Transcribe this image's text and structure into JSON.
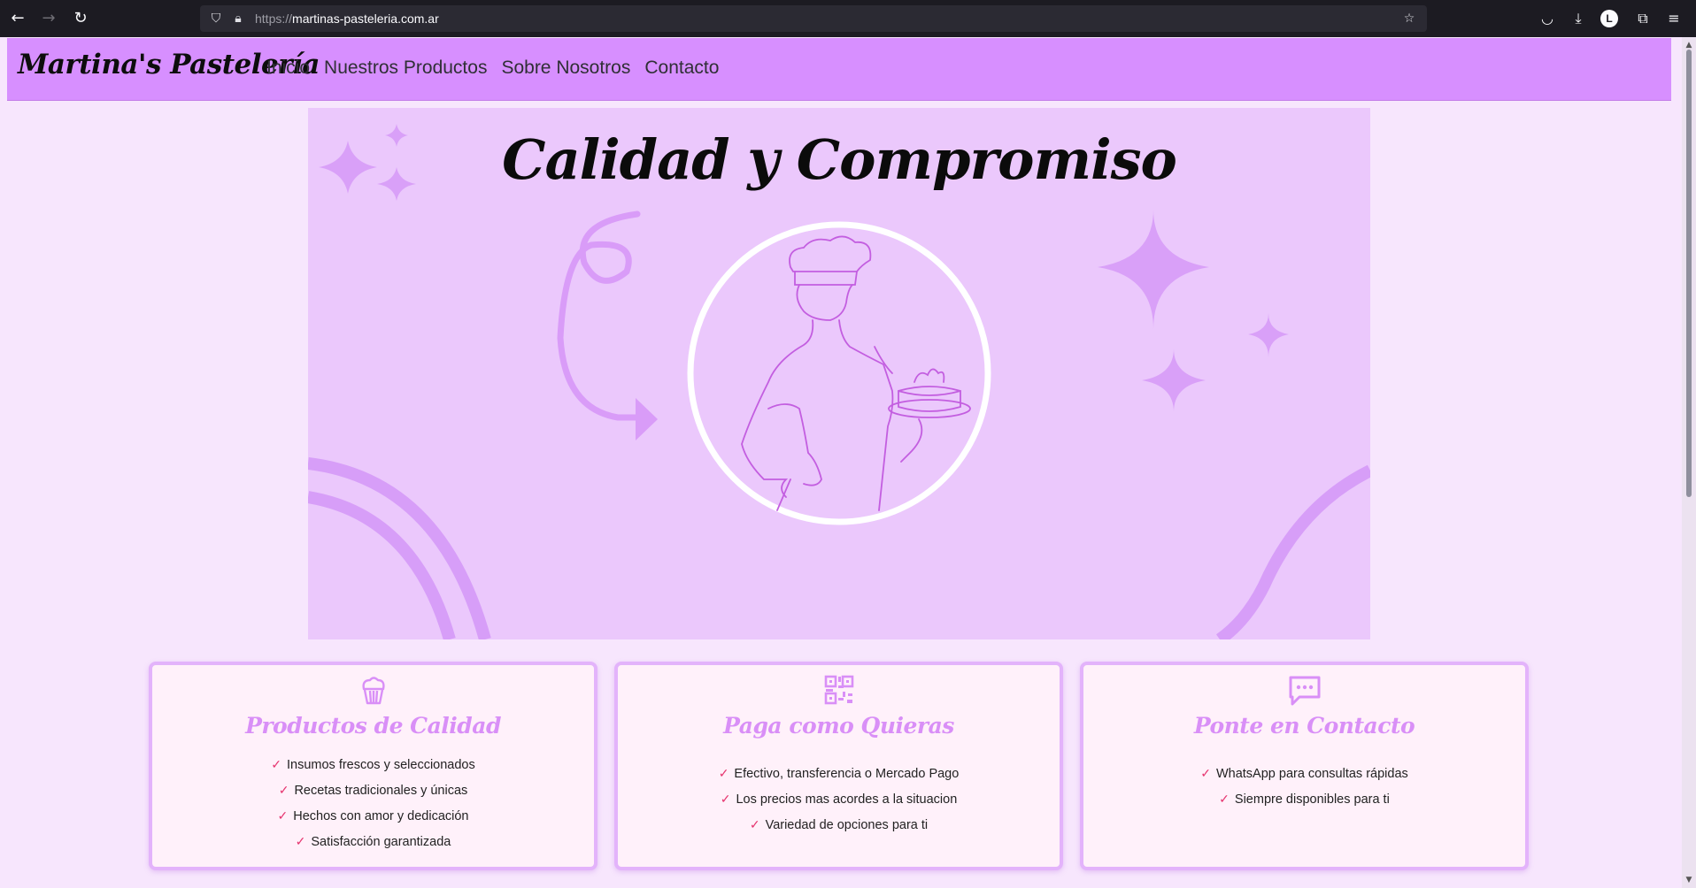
{
  "browser": {
    "url_scheme": "https://",
    "url_host": "martinas-pasteleria.com.ar",
    "avatar_letter": "L"
  },
  "site": {
    "logo": "Martina's Pastelería",
    "nav": [
      "Inicio",
      "Nuestros Productos",
      "Sobre Nosotros",
      "Contacto"
    ]
  },
  "hero": {
    "title": "Calidad y Compromiso"
  },
  "cards": [
    {
      "icon": "cupcake-icon",
      "title": "Productos de Calidad",
      "items": [
        "Insumos frescos y seleccionados",
        "Recetas tradicionales y únicas",
        "Hechos con amor y dedicación",
        "Satisfacción garantizada"
      ]
    },
    {
      "icon": "qr-code-icon",
      "title": "Paga como Quieras",
      "items": [
        "Efectivo, transferencia o Mercado Pago",
        "Los precios mas acordes a la situacion",
        "Variedad de opciones para ti"
      ]
    },
    {
      "icon": "chat-icon",
      "title": "Ponte en Contacto",
      "items": [
        "WhatsApp para consultas rápidas",
        "Siempre disponibles para ti"
      ]
    }
  ],
  "colors": {
    "header": "#d78fff",
    "page": "#f7e6fd",
    "hero": "#ebc8fc",
    "accent": "#d98ff7",
    "check": "#e6356f"
  }
}
